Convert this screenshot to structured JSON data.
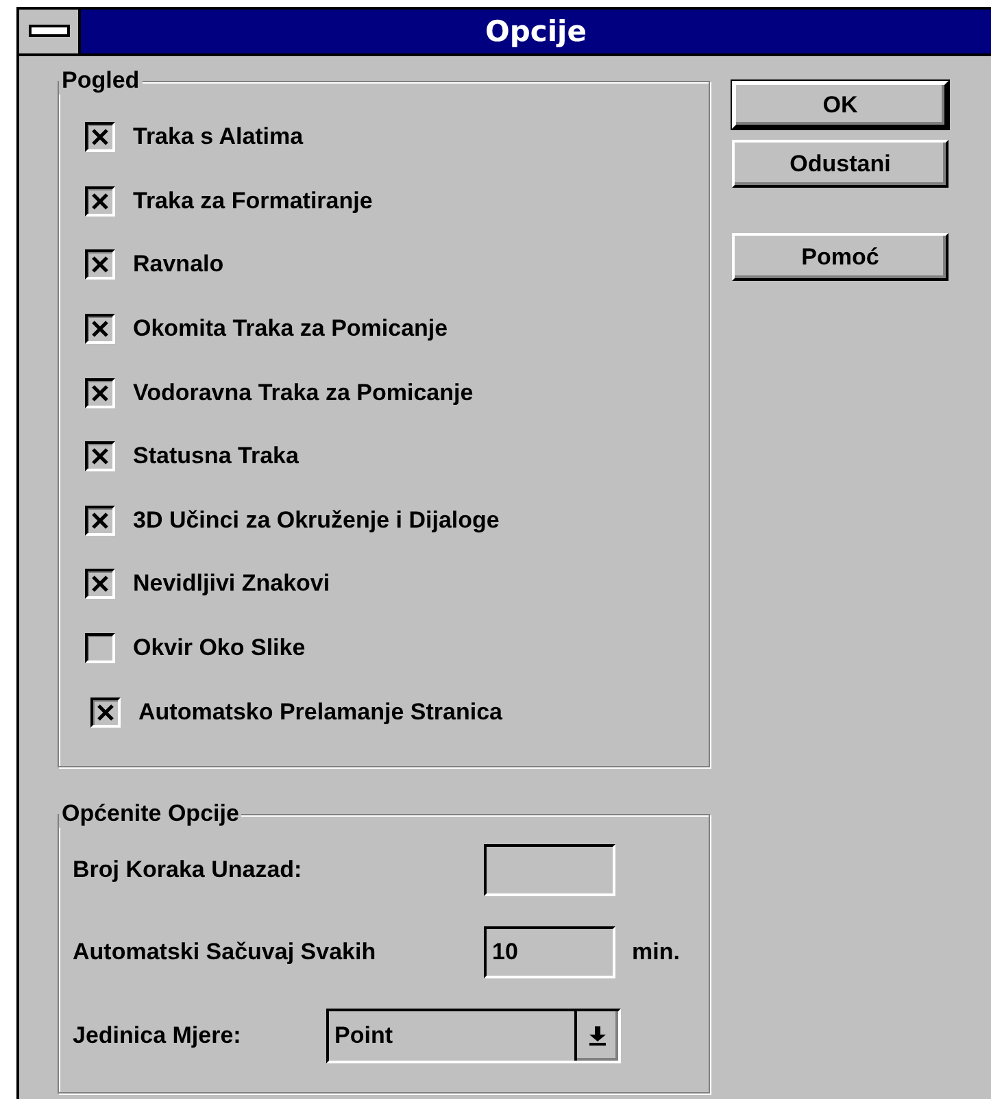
{
  "window": {
    "title": "Opcije"
  },
  "view_group": {
    "title": "Pogled",
    "options": [
      {
        "label": "Traka s Alatima",
        "checked": true
      },
      {
        "label": "Traka za Formatiranje",
        "checked": true
      },
      {
        "label": "Ravnalo",
        "checked": true
      },
      {
        "label": "Okomita Traka za Pomicanje",
        "checked": true
      },
      {
        "label": "Vodoravna Traka za Pomicanje",
        "checked": true
      },
      {
        "label": "Statusna Traka",
        "checked": true
      },
      {
        "label": "3D Učinci za Okruženje i Dijaloge",
        "checked": true
      },
      {
        "label": "Nevidljivi Znakovi",
        "checked": true
      },
      {
        "label": "Okvir Oko Slike",
        "checked": false
      },
      {
        "label": "Automatsko Prelamanje Stranica",
        "checked": true
      }
    ]
  },
  "general_group": {
    "title": "Općenite Opcije",
    "undo_steps": {
      "label": "Broj Koraka Unazad:"
    },
    "autosave": {
      "label": "Automatski Sačuvaj Svakih",
      "value": "10",
      "unit": "min."
    },
    "unit": {
      "label": "Jedinica Mjere:",
      "value": "Point"
    }
  },
  "buttons": [
    {
      "label": "OK",
      "default": true
    },
    {
      "label": "Odustani",
      "default": false
    },
    {
      "label": "Pomoć",
      "default": false
    }
  ]
}
